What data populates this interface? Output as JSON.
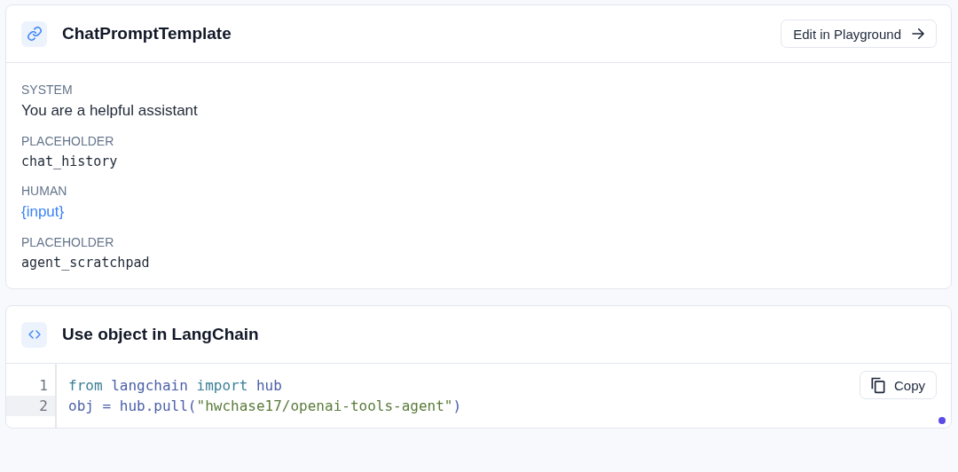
{
  "prompt_card": {
    "title": "ChatPromptTemplate",
    "action_button": "Edit in Playground",
    "messages": [
      {
        "role": "SYSTEM",
        "kind": "text",
        "content": "You are a helpful assistant"
      },
      {
        "role": "PLACEHOLDER",
        "kind": "code",
        "content": "chat_history"
      },
      {
        "role": "HUMAN",
        "kind": "variable",
        "content": "{input}"
      },
      {
        "role": "PLACEHOLDER",
        "kind": "code",
        "content": "agent_scratchpad"
      }
    ]
  },
  "usage_card": {
    "title": "Use object in LangChain",
    "copy_button": "Copy",
    "code_lines": [
      {
        "number": "1",
        "selected": false,
        "tokens": [
          {
            "kind": "keyword",
            "text": "from "
          },
          {
            "kind": "name",
            "text": "langchain "
          },
          {
            "kind": "keyword",
            "text": "import "
          },
          {
            "kind": "name",
            "text": "hub"
          }
        ]
      },
      {
        "number": "2",
        "selected": true,
        "tokens": [
          {
            "kind": "name",
            "text": "obj = hub.pull("
          },
          {
            "kind": "string",
            "text": "\"hwchase17/openai-tools-agent\""
          },
          {
            "kind": "name",
            "text": ")"
          }
        ]
      }
    ]
  }
}
